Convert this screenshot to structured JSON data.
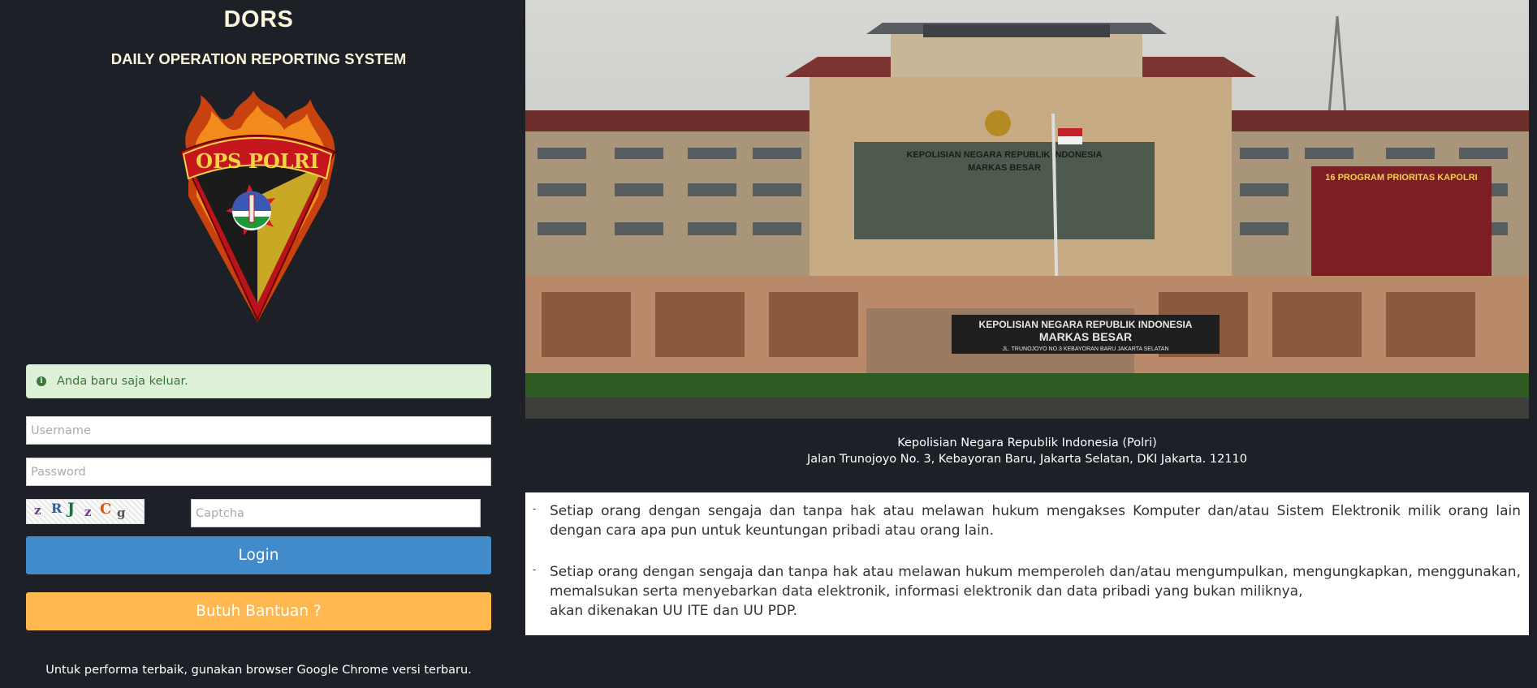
{
  "app": {
    "title": "DORS",
    "subtitle": "DAILY OPERATION REPORTING SYSTEM",
    "logo_text": "OPS POLRI"
  },
  "alert": {
    "icon": "info-icon",
    "message": "Anda baru saja keluar.",
    "color": "#3c763d",
    "background": "#dff0d8"
  },
  "form": {
    "username_placeholder": "Username",
    "password_placeholder": "Password",
    "captcha_placeholder": "Captcha",
    "captcha_chars": [
      "z",
      "R",
      "J",
      "z",
      "C",
      "g"
    ],
    "login_label": "Login",
    "help_label": "Butuh Bantuan ?",
    "login_color": "#428bca",
    "help_color": "#ffb84f"
  },
  "footer": {
    "browser_note": "Untuk performa terbaik, gunakan browser Google Chrome versi terbaru."
  },
  "building_photo": {
    "sign_line1": "KEPOLISIAN NEGARA REPUBLIK INDONESIA",
    "sign_line2": "MARKAS BESAR",
    "sign_line3": "JL. TRUNOJOYO NO.3 KEBAYORAN BARU JAKARTA SELATAN",
    "banner": "16 PROGRAM PRIORITAS KAPOLRI"
  },
  "address": {
    "line1": "Kepolisian Negara Republik Indonesia (Polri)",
    "line2": "Jalan Trunojoyo No. 3, Kebayoran Baru, Jakarta Selatan, DKI Jakarta. 12110"
  },
  "notice": {
    "bullet": "-",
    "item1": "Setiap orang dengan sengaja dan tanpa hak atau melawan hukum mengakses Komputer dan/atau Sistem Elektronik milik orang lain dengan cara apa pun untuk keuntungan pribadi atau orang lain.",
    "item2_line1": "Setiap orang dengan sengaja dan tanpa hak atau melawan hukum memperoleh dan/atau mengumpulkan, mengungkapkan, menggunakan, memalsukan serta menyebarkan data elektronik, informasi elektronik dan data pribadi yang bukan miliknya,",
    "item2_line2": "akan dikenakan UU ITE dan UU PDP."
  }
}
